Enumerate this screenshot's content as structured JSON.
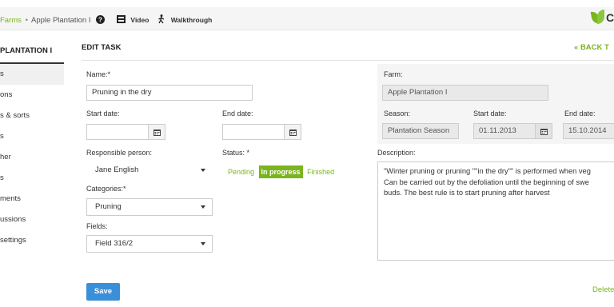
{
  "topbar": {
    "crumb_farms": "Farms",
    "crumb_sep": "•",
    "crumb_current": "Apple Plantation I",
    "help_icon": "question-circle-icon",
    "video_label": "Video",
    "video_icon": "film-icon",
    "walkthrough_label": "Walkthrough",
    "walkthrough_icon": "walking-person-icon",
    "logo_text": "C"
  },
  "sidebar": {
    "title": "PLANTATION I",
    "items": [
      {
        "label": "s"
      },
      {
        "label": "ons"
      },
      {
        "label": "s & sorts"
      },
      {
        "label": "s"
      },
      {
        "label": "her"
      },
      {
        "label": "s"
      },
      {
        "label": "ments"
      },
      {
        "label": "ussions"
      },
      {
        "label": " settings"
      }
    ]
  },
  "header": {
    "title": "EDIT TASK",
    "back_label": "BACK T",
    "back_icon": "double-chevron-left-icon"
  },
  "form": {
    "name_label": "Name:*",
    "name_value": "Pruning in the dry",
    "start_label": "Start date:",
    "start_value": "",
    "end_label": "End date:",
    "end_value": "",
    "calendar_icon": "calendar-icon",
    "responsible_label": "Responsible person:",
    "responsible_value": "Jane English",
    "status_label": "Status: *",
    "status_options": [
      "Pending",
      "In progress",
      "Finished"
    ],
    "status_selected": "In progress",
    "categories_label": "Categories:*",
    "categories_value": "Pruning",
    "fields_label": "Fields:",
    "fields_value": "Field 316/2"
  },
  "farm": {
    "farm_label": "Farm:",
    "farm_value": "Apple Plantation I",
    "season_label": "Season:",
    "season_value": "Plantation Season",
    "start_label": "Start date:",
    "start_value": "01.11.2013",
    "end_label": "End date:",
    "end_value": "15.10.2014"
  },
  "description": {
    "label": "Description:",
    "text": "\"Winter pruning or pruning \"\"in the dry\"\" is performed when veg\nCan be carried out by the defoliation until the beginning of swe\nbuds. The best rule is to start pruning after harvest"
  },
  "actions": {
    "save_label": "Save",
    "delete_label": "Delete"
  },
  "colors": {
    "accent_green": "#7ab51d",
    "save_blue": "#3a8fd9"
  }
}
